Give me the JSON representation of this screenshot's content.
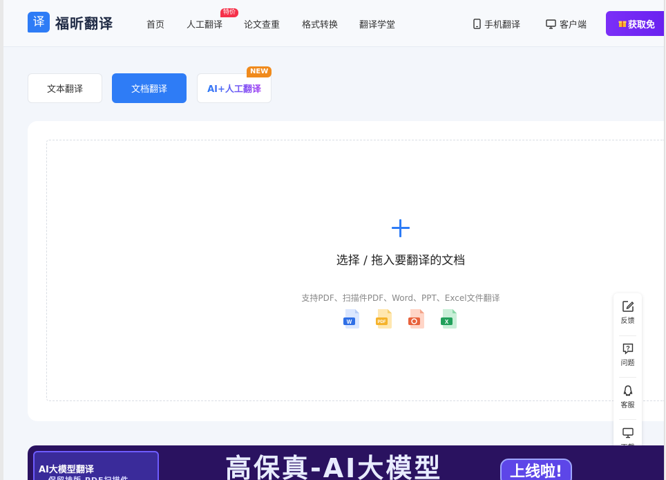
{
  "header": {
    "logo_glyph": "译",
    "brand": "福昕翻译",
    "nav": [
      "首页",
      "人工翻译",
      "论文查重",
      "格式转换",
      "翻译学堂"
    ],
    "hot_badge": "特价",
    "utils": {
      "mobile": "手机翻译",
      "client": "客户端"
    },
    "cta": "获取免"
  },
  "tabs": {
    "text": "文本翻译",
    "doc": "文档翻译",
    "ai": "AI+人工翻译",
    "new_badge": "NEW"
  },
  "upload": {
    "title": "选择 / 拖入要翻译的文档",
    "subtitle": "支持PDF、扫描件PDF、Word、PPT、Excel文件翻译",
    "file_types": [
      {
        "label": "W",
        "color": "#2f6fe6"
      },
      {
        "label": "PDF",
        "color": "#f5b32b"
      },
      {
        "label": "P",
        "color": "#e8623c"
      },
      {
        "label": "X",
        "color": "#22a05b"
      }
    ]
  },
  "side_tools": [
    "反馈",
    "问题",
    "客服",
    "下载"
  ],
  "banner": {
    "tag": "AI大模型翻译",
    "sub": "保留排版 PDF扫描件",
    "headline": "高保真-AI大模型",
    "pill": "上线啦!"
  }
}
